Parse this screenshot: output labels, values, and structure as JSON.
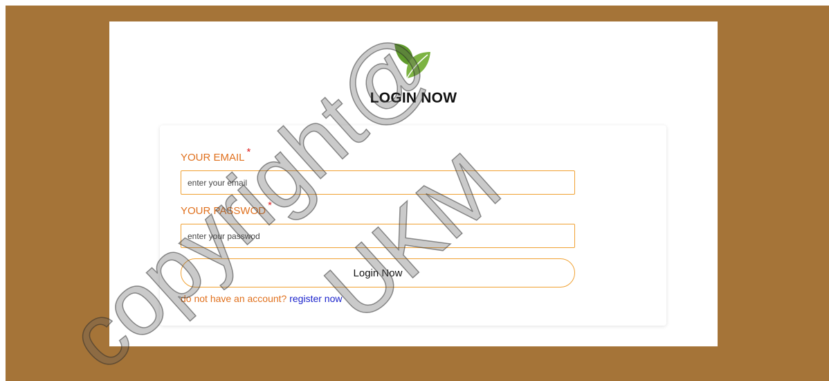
{
  "page": {
    "title": "LOGIN NOW"
  },
  "logo": {
    "icon": "leaf-icon",
    "colors": [
      "#5f9a2c",
      "#7cb342"
    ]
  },
  "form": {
    "email": {
      "label": "YOUR EMAIL",
      "required_mark": "*",
      "placeholder": "enter your email",
      "value": ""
    },
    "password": {
      "label": "YOUR PASSWOD",
      "required_mark": "*",
      "placeholder": "enter your passwod",
      "value": ""
    },
    "submit_label": "Login Now",
    "register_prompt": "do not have an account?",
    "register_link": "register now"
  },
  "watermark": {
    "line1": "copyright@",
    "line2": "UKM"
  },
  "colors": {
    "background": "#a57438",
    "accent": "#e0701d",
    "input_border": "#f0a030",
    "link": "#1a22cc",
    "required": "#e02020"
  }
}
